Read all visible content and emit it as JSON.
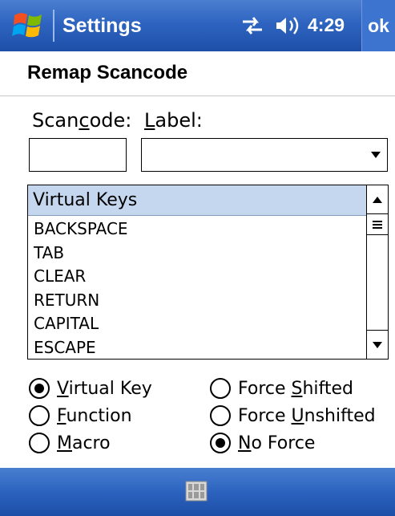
{
  "titlebar": {
    "app_title": "Settings",
    "clock": "4:29",
    "ok_label": "ok"
  },
  "page": {
    "title": "Remap Scancode"
  },
  "fields": {
    "scancode_label": {
      "before": "Scan",
      "accel": "c",
      "after": "ode:"
    },
    "label_label": {
      "before": "",
      "accel": "L",
      "after": "abel:"
    },
    "scancode_value": "",
    "label_value": ""
  },
  "virtual_keys": {
    "header": "Virtual Keys",
    "items": [
      "BACKSPACE",
      "TAB",
      "CLEAR",
      "RETURN",
      "CAPITAL",
      "ESCAPE"
    ]
  },
  "radios": {
    "virtual_key": {
      "before": "",
      "accel": "V",
      "after": "irtual Key",
      "checked": true
    },
    "function": {
      "before": "",
      "accel": "F",
      "after": "unction",
      "checked": false
    },
    "macro": {
      "before": "",
      "accel": "M",
      "after": "acro",
      "checked": false
    },
    "force_shifted": {
      "before": "Force ",
      "accel": "S",
      "after": "hifted",
      "checked": false
    },
    "force_unshifted": {
      "before": "Force ",
      "accel": "U",
      "after": "nshifted",
      "checked": false
    },
    "no_force": {
      "before": "",
      "accel": "N",
      "after": "o Force",
      "checked": true
    }
  },
  "icons": {
    "start": "windows-flag-icon",
    "connectivity": "connectivity-arrows-icon",
    "volume": "speaker-icon",
    "keyboard": "input-panel-icon"
  },
  "colors": {
    "titlebar": "#2e64c0",
    "list_header": "#c5d7ee"
  }
}
